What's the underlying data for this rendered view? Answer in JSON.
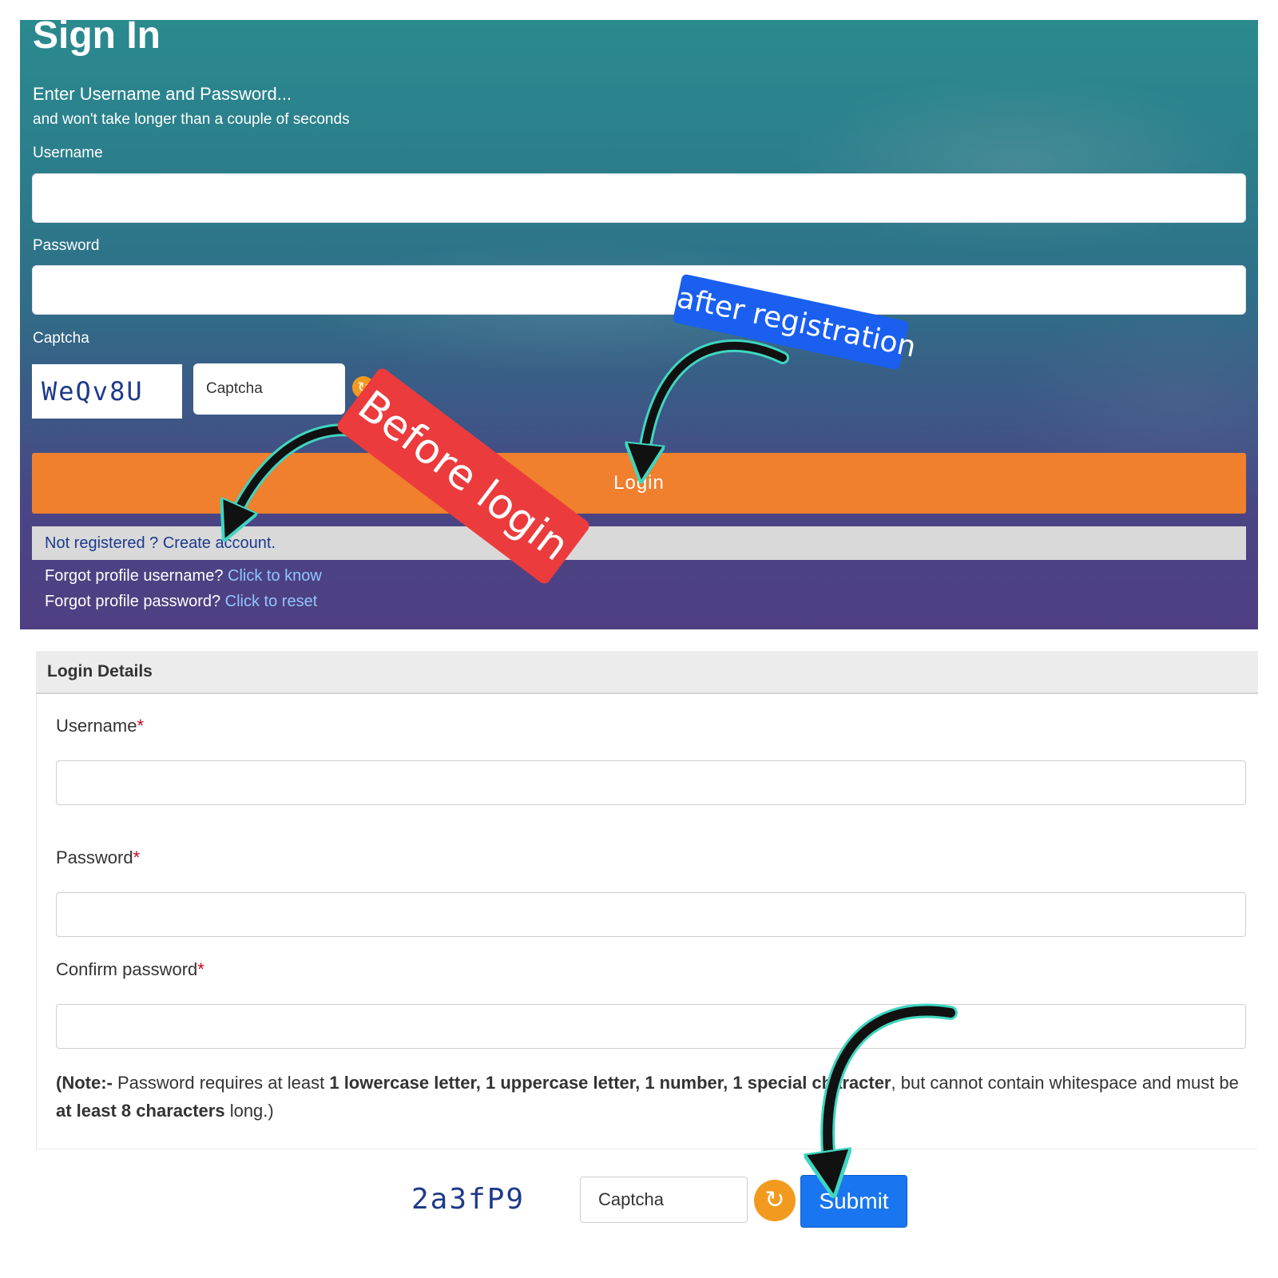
{
  "signin": {
    "title": "Sign In",
    "subtitle": "Enter Username and Password...",
    "subtitle2": "and won't take longer than a couple of seconds",
    "username_label": "Username",
    "password_label": "Password",
    "captcha_label": "Captcha",
    "captcha_code": "WeQv8U",
    "captcha_placeholder": "Captcha",
    "login_label": "Login",
    "register_text": "Not registered ? Create account.",
    "forgot_username_text": "Forgot profile username? ",
    "forgot_username_link": "Click to know",
    "forgot_password_text": "Forgot profile password? ",
    "forgot_password_link": "Click to reset"
  },
  "annotations": {
    "before_login": "Before login",
    "after_registration": "after registration"
  },
  "details": {
    "header": "Login Details",
    "username_label": "Username",
    "password_label": "Password",
    "confirm_label": "Confirm password",
    "required_mark": "*",
    "note": {
      "prefix": "(Note:-",
      "t1": " Password requires at least ",
      "b1": "1 lowercase letter, 1 uppercase letter, 1 number, 1 special character",
      "t2": ", but cannot contain whitespace and must be ",
      "b2": "at least 8 characters",
      "t3": " long.)"
    },
    "captcha_code": "2a3fP9",
    "captcha_placeholder": "Captcha",
    "refresh_icon": "refresh-icon",
    "submit_label": "Submit"
  },
  "colors": {
    "login_button": "#f07f2e",
    "submit_button": "#1976f0",
    "tag_red": "#ec3b3d",
    "tag_blue": "#1a5ff0",
    "refresh": "#f29a1f"
  }
}
